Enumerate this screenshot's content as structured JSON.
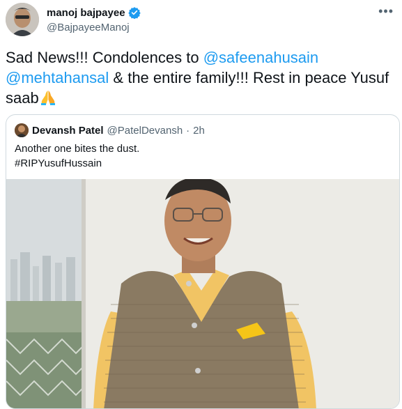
{
  "tweet": {
    "author": {
      "name": "manoj bajpayee",
      "handle": "@BajpayeeManoj",
      "verified": true
    },
    "text": {
      "part1": "Sad News!!! Condolences to ",
      "mention1": "@safeenahusain",
      "mention2": "@mehtahansal",
      "part2": " & the entire family!!! Rest in peace Yusuf saab"
    },
    "emoji": "folded-hands-icon",
    "quoted": {
      "name": "Devansh Patel",
      "handle": "@PatelDevansh",
      "separator": "·",
      "time": "2h",
      "line1": "Another one bites the dust.",
      "line2": "#RIPYusufHussain"
    }
  },
  "colors": {
    "link": "#1d9bf0",
    "text": "#0f1419",
    "secondary": "#536471",
    "border": "#cfd9de",
    "verified": "#1d9bf0"
  }
}
